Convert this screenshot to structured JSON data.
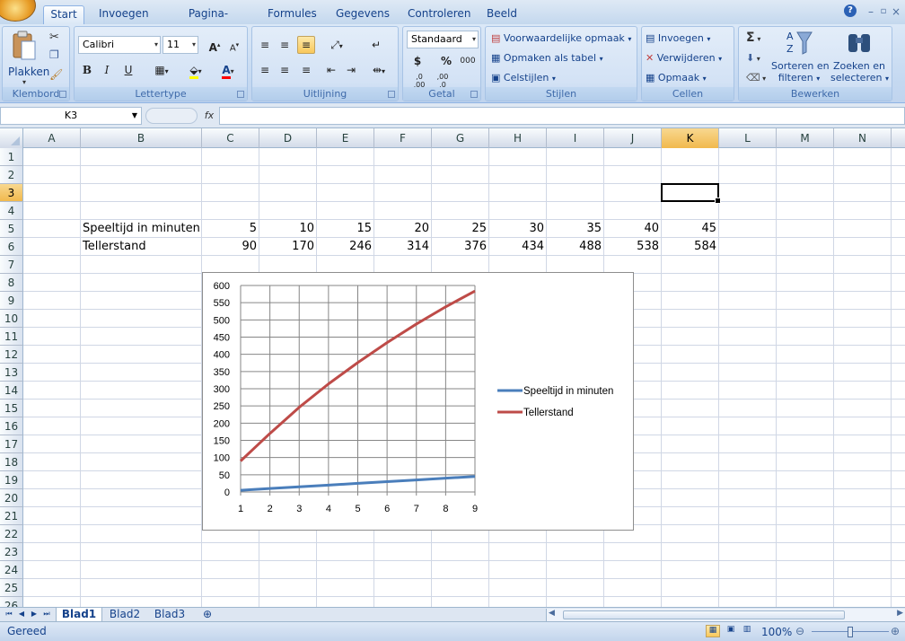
{
  "ribbon_tabs": [
    "Start",
    "Invoegen",
    "Pagina-indeling",
    "Formules",
    "Gegevens",
    "Controleren",
    "Beeld"
  ],
  "groups": {
    "clipboard": {
      "title": "Klembord",
      "paste": "Plakken"
    },
    "font": {
      "title": "Lettertype",
      "name": "Calibri",
      "size": "11",
      "bold": "B",
      "italic": "I",
      "underline": "U"
    },
    "alignment": {
      "title": "Uitlijning"
    },
    "number": {
      "title": "Getal",
      "format": "Standaard",
      "currency": "$",
      "percent": "%",
      "thousands": "000",
      "inc_decimal": ",0 ,00",
      "dec_decimal": ",00 ,0"
    },
    "styles": {
      "title": "Stijlen",
      "conditional": "Voorwaardelijke opmaak",
      "as_table": "Opmaken als tabel",
      "cell_styles": "Celstijlen"
    },
    "cells": {
      "title": "Cellen",
      "insert": "Invoegen",
      "delete": "Verwijderen",
      "format": "Opmaak"
    },
    "editing": {
      "title": "Bewerken",
      "sort_line1": "Sorteren en",
      "sort_line2": "filteren",
      "find_line1": "Zoeken en",
      "find_line2": "selecteren",
      "sigma": "Σ"
    }
  },
  "formula_bar": {
    "name_box": "K3",
    "fx": "fx",
    "value": ""
  },
  "columns": [
    "A",
    "B",
    "C",
    "D",
    "E",
    "F",
    "G",
    "H",
    "I",
    "J",
    "K",
    "L",
    "M",
    "N"
  ],
  "rows": [
    "1",
    "2",
    "3",
    "4",
    "5",
    "6",
    "7",
    "8",
    "9",
    "10",
    "11",
    "12",
    "13",
    "14",
    "15",
    "16",
    "17",
    "18",
    "19",
    "20",
    "21",
    "22",
    "23",
    "24",
    "25",
    "26"
  ],
  "active_cell": "K3",
  "table": {
    "row5_label": "Speeltijd in minuten",
    "row5_values": [
      "5",
      "10",
      "15",
      "20",
      "25",
      "30",
      "35",
      "40",
      "45"
    ],
    "row6_label": "Tellerstand",
    "row6_values": [
      "90",
      "170",
      "246",
      "314",
      "376",
      "434",
      "488",
      "538",
      "584"
    ]
  },
  "chart_data": {
    "type": "line",
    "categories": [
      "1",
      "2",
      "3",
      "4",
      "5",
      "6",
      "7",
      "8",
      "9"
    ],
    "series": [
      {
        "name": "Speeltijd in minuten",
        "values": [
          5,
          10,
          15,
          20,
          25,
          30,
          35,
          40,
          45
        ],
        "color": "#4a7ebb"
      },
      {
        "name": "Tellerstand",
        "values": [
          90,
          170,
          246,
          314,
          376,
          434,
          488,
          538,
          584
        ],
        "color": "#be4b48"
      }
    ],
    "ylim": [
      0,
      600
    ],
    "yticks": [
      "0",
      "50",
      "100",
      "150",
      "200",
      "250",
      "300",
      "350",
      "400",
      "450",
      "500",
      "550",
      "600"
    ],
    "grid": true,
    "legend": "right"
  },
  "sheets": [
    "Blad1",
    "Blad2",
    "Blad3"
  ],
  "status": {
    "text": "Gereed",
    "zoom": "100%"
  }
}
